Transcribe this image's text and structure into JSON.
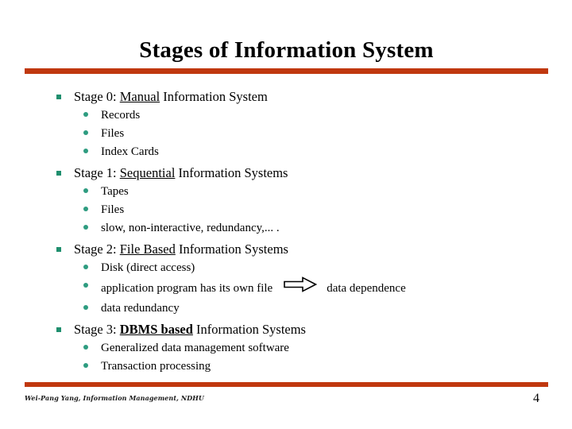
{
  "slide": {
    "title": "Stages of Information System",
    "page_number": "4",
    "footer": "Wei-Pang Yang, Information Management, NDHU",
    "accent_color": "#c0380f",
    "bullet_square_color": "#1f8f6e",
    "bullet_dot_color": "#2e9c80"
  },
  "content": {
    "groups": [
      {
        "heading_prefix": "Stage 0: ",
        "heading_keyword": "Manual",
        "heading_suffix": " Information System",
        "keyword_style": "underline",
        "items": [
          {
            "text": "Records"
          },
          {
            "text": "Files"
          },
          {
            "text": "Index Cards"
          }
        ]
      },
      {
        "heading_prefix": "Stage 1: ",
        "heading_keyword": "Sequential",
        "heading_suffix": " Information Systems",
        "keyword_style": "underline",
        "items": [
          {
            "text": "Tapes"
          },
          {
            "text": "Files"
          },
          {
            "text": "slow, non-interactive, redundancy,... ."
          }
        ]
      },
      {
        "heading_prefix": "Stage 2: ",
        "heading_keyword": "File Based",
        "heading_suffix": " Information Systems",
        "keyword_style": "underline",
        "items": [
          {
            "text": "Disk (direct access)"
          },
          {
            "text": "application program has its own file",
            "arrow_icon": "right-block-arrow",
            "text_after_arrow": "data dependence"
          },
          {
            "text": "data redundancy"
          }
        ]
      },
      {
        "heading_prefix": "Stage 3: ",
        "heading_keyword": "DBMS based",
        "heading_suffix": " Information Systems",
        "keyword_style": "bold-underline",
        "items": [
          {
            "text": "Generalized data management software"
          },
          {
            "text": "Transaction processing"
          }
        ]
      }
    ]
  }
}
